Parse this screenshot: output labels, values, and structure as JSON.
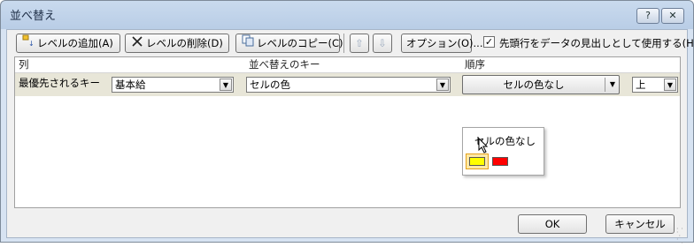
{
  "window": {
    "title": "並べ替え",
    "help_label": "?",
    "close_label": "✕"
  },
  "toolbar": {
    "add_label": "レベルの追加(A)",
    "delete_label": "レベルの削除(D)",
    "copy_label": "レベルのコピー(C)",
    "up_label": "⇧",
    "down_label": "⇩",
    "options_label": "オプション(O)...",
    "header_checkbox_checked": true,
    "header_checkbox_mark": "✓",
    "header_checkbox_label": "先頭行をデータの見出しとして使用する(H)"
  },
  "grid": {
    "headers": {
      "column": "列",
      "sort_on": "並べ替えのキー",
      "order": "順序"
    },
    "rows": [
      {
        "label": "最優先されるキー",
        "column": "基本給",
        "sort_on": "セルの色",
        "order_color": "セルの色なし",
        "position": "上"
      }
    ]
  },
  "color_popup": {
    "title": "セルの色なし",
    "swatches": [
      {
        "color": "#ffff00",
        "selected": true
      },
      {
        "color": "#ff0000",
        "selected": false
      }
    ]
  },
  "footer": {
    "ok_label": "OK",
    "cancel_label": "キャンセル"
  },
  "icons": {
    "add": "add-level-icon",
    "delete": "delete-x-icon",
    "copy": "copy-icon",
    "arrow": "▼"
  }
}
